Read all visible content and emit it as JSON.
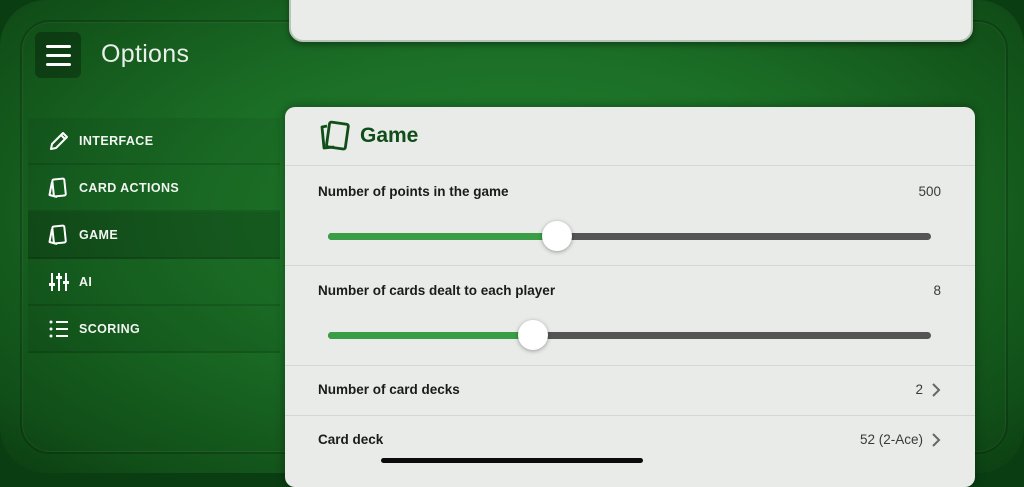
{
  "header": {
    "title": "Options"
  },
  "sidebar": {
    "items": [
      {
        "label": "INTERFACE",
        "icon": "pencil-icon"
      },
      {
        "label": "CARD ACTIONS",
        "icon": "cards-icon"
      },
      {
        "label": "GAME",
        "icon": "cards-icon"
      },
      {
        "label": "AI",
        "icon": "sliders-icon"
      },
      {
        "label": "SCORING",
        "icon": "list-icon"
      }
    ],
    "active_index": 2
  },
  "panel": {
    "title": "Game",
    "icon": "cards-icon",
    "settings": [
      {
        "label": "Number of points in the game",
        "value": "500",
        "type": "slider",
        "fill_fraction": 0.38
      },
      {
        "label": "Number of cards dealt to each player",
        "value": "8",
        "type": "slider",
        "fill_fraction": 0.34
      },
      {
        "label": "Number of card decks",
        "value": "2",
        "type": "navigation"
      },
      {
        "label": "Card deck",
        "value": "52 (2-Ace)",
        "type": "navigation"
      }
    ]
  },
  "colors": {
    "felt": "#1b6e26",
    "panel_bg": "#e8ebe8",
    "accent_green": "#3a9e47",
    "title_green": "#104d18",
    "track_gray": "#555555"
  }
}
